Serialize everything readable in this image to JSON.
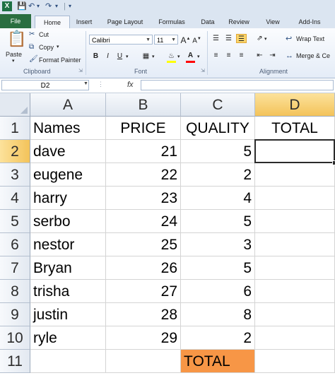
{
  "qat": {
    "app_icon": "X"
  },
  "tabs": [
    "File",
    "Home",
    "Insert",
    "Page Layout",
    "Formulas",
    "Data",
    "Review",
    "View",
    "Add-Ins"
  ],
  "ribbon": {
    "clipboard": {
      "paste": "Paste",
      "cut": "Cut",
      "copy": "Copy",
      "format_painter": "Format Painter",
      "label": "Clipboard"
    },
    "font": {
      "name": "Calibri",
      "size": "11",
      "bold": "B",
      "italic": "I",
      "underline": "U",
      "label": "Font"
    },
    "alignment": {
      "wrap": "Wrap Text",
      "merge": "Merge & Ce",
      "label": "Alignment"
    }
  },
  "formula_bar": {
    "name_box": "D2",
    "fx": "fx",
    "content": ""
  },
  "sheet": {
    "columns": [
      "A",
      "B",
      "C",
      "D"
    ],
    "active_column": "D",
    "active_row": "2",
    "rows": [
      {
        "num": "1",
        "cells": [
          "Names",
          "PRICE",
          "QUALITY",
          "TOTAL"
        ]
      },
      {
        "num": "2",
        "cells": [
          "dave",
          "21",
          "5",
          ""
        ]
      },
      {
        "num": "3",
        "cells": [
          "eugene",
          "22",
          "2",
          ""
        ]
      },
      {
        "num": "4",
        "cells": [
          "harry",
          "23",
          "4",
          ""
        ]
      },
      {
        "num": "5",
        "cells": [
          "serbo",
          "24",
          "5",
          ""
        ]
      },
      {
        "num": "6",
        "cells": [
          "nestor",
          "25",
          "3",
          ""
        ]
      },
      {
        "num": "7",
        "cells": [
          "Bryan",
          "26",
          "5",
          ""
        ]
      },
      {
        "num": "8",
        "cells": [
          "trisha",
          "27",
          "6",
          ""
        ]
      },
      {
        "num": "9",
        "cells": [
          "justin",
          "28",
          "8",
          ""
        ]
      },
      {
        "num": "10",
        "cells": [
          "ryle",
          "29",
          "2",
          ""
        ]
      },
      {
        "num": "11",
        "cells": [
          "",
          "",
          "TOTAL",
          ""
        ]
      }
    ],
    "highlight_color": "#f79646"
  }
}
